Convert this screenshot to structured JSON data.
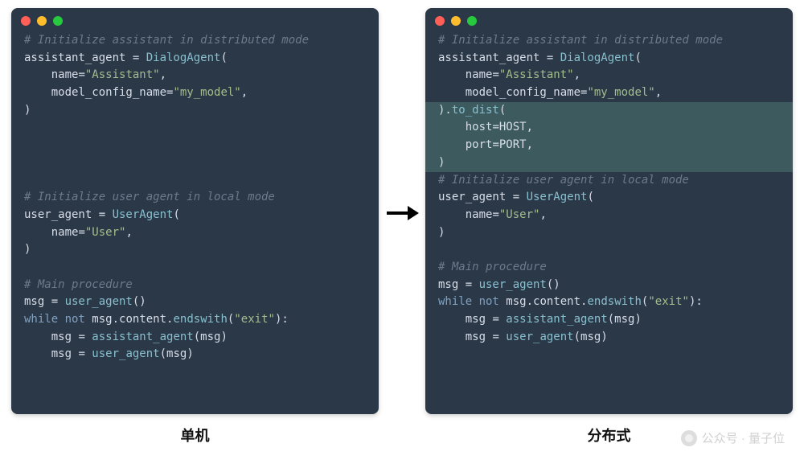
{
  "labels": {
    "left": "单机",
    "right": "分布式"
  },
  "watermark": "公众号 · 量子位",
  "left_code": {
    "lines": [
      {
        "hl": false,
        "tokens": [
          {
            "cls": "c-cm",
            "t": "# Initialize assistant in distributed mode"
          }
        ]
      },
      {
        "hl": false,
        "tokens": [
          {
            "cls": "c-id",
            "t": "assistant_agent "
          },
          {
            "cls": "c-op",
            "t": "= "
          },
          {
            "cls": "c-fn",
            "t": "DialogAgent"
          },
          {
            "cls": "c-pu",
            "t": "("
          }
        ]
      },
      {
        "hl": false,
        "tokens": [
          {
            "cls": "c-arg",
            "t": "    name"
          },
          {
            "cls": "c-op",
            "t": "="
          },
          {
            "cls": "c-str",
            "t": "\"Assistant\""
          },
          {
            "cls": "c-pu",
            "t": ","
          }
        ]
      },
      {
        "hl": false,
        "tokens": [
          {
            "cls": "c-arg",
            "t": "    model_config_name"
          },
          {
            "cls": "c-op",
            "t": "="
          },
          {
            "cls": "c-str",
            "t": "\"my_model\""
          },
          {
            "cls": "c-pu",
            "t": ","
          }
        ]
      },
      {
        "hl": false,
        "tokens": [
          {
            "cls": "c-pu",
            "t": ")"
          }
        ]
      },
      {
        "hl": false,
        "tokens": [
          {
            "cls": "c-pu",
            "t": " "
          }
        ]
      },
      {
        "hl": false,
        "tokens": [
          {
            "cls": "c-pu",
            "t": " "
          }
        ]
      },
      {
        "hl": false,
        "tokens": [
          {
            "cls": "c-pu",
            "t": " "
          }
        ]
      },
      {
        "hl": false,
        "tokens": [
          {
            "cls": "c-pu",
            "t": " "
          }
        ]
      },
      {
        "hl": false,
        "tokens": [
          {
            "cls": "c-cm",
            "t": "# Initialize user agent in local mode"
          }
        ]
      },
      {
        "hl": false,
        "tokens": [
          {
            "cls": "c-id",
            "t": "user_agent "
          },
          {
            "cls": "c-op",
            "t": "= "
          },
          {
            "cls": "c-fn",
            "t": "UserAgent"
          },
          {
            "cls": "c-pu",
            "t": "("
          }
        ]
      },
      {
        "hl": false,
        "tokens": [
          {
            "cls": "c-arg",
            "t": "    name"
          },
          {
            "cls": "c-op",
            "t": "="
          },
          {
            "cls": "c-str",
            "t": "\"User\""
          },
          {
            "cls": "c-pu",
            "t": ","
          }
        ]
      },
      {
        "hl": false,
        "tokens": [
          {
            "cls": "c-pu",
            "t": ")"
          }
        ]
      },
      {
        "hl": false,
        "tokens": [
          {
            "cls": "c-pu",
            "t": " "
          }
        ]
      },
      {
        "hl": false,
        "tokens": [
          {
            "cls": "c-cm",
            "t": "# Main procedure"
          }
        ]
      },
      {
        "hl": false,
        "tokens": [
          {
            "cls": "c-id",
            "t": "msg "
          },
          {
            "cls": "c-op",
            "t": "= "
          },
          {
            "cls": "c-fn",
            "t": "user_agent"
          },
          {
            "cls": "c-pu",
            "t": "()"
          }
        ]
      },
      {
        "hl": false,
        "tokens": [
          {
            "cls": "c-kw",
            "t": "while "
          },
          {
            "cls": "c-kw",
            "t": "not "
          },
          {
            "cls": "c-id",
            "t": "msg"
          },
          {
            "cls": "c-dot",
            "t": "."
          },
          {
            "cls": "c-id",
            "t": "content"
          },
          {
            "cls": "c-dot",
            "t": "."
          },
          {
            "cls": "c-fn",
            "t": "endswith"
          },
          {
            "cls": "c-pu",
            "t": "("
          },
          {
            "cls": "c-str",
            "t": "\"exit\""
          },
          {
            "cls": "c-pu",
            "t": "):"
          }
        ]
      },
      {
        "hl": false,
        "tokens": [
          {
            "cls": "c-id",
            "t": "    msg "
          },
          {
            "cls": "c-op",
            "t": "= "
          },
          {
            "cls": "c-fn",
            "t": "assistant_agent"
          },
          {
            "cls": "c-pu",
            "t": "("
          },
          {
            "cls": "c-id",
            "t": "msg"
          },
          {
            "cls": "c-pu",
            "t": ")"
          }
        ]
      },
      {
        "hl": false,
        "tokens": [
          {
            "cls": "c-id",
            "t": "    msg "
          },
          {
            "cls": "c-op",
            "t": "= "
          },
          {
            "cls": "c-fn",
            "t": "user_agent"
          },
          {
            "cls": "c-pu",
            "t": "("
          },
          {
            "cls": "c-id",
            "t": "msg"
          },
          {
            "cls": "c-pu",
            "t": ")"
          }
        ]
      },
      {
        "hl": false,
        "tokens": [
          {
            "cls": "c-pu",
            "t": " "
          }
        ]
      },
      {
        "hl": false,
        "tokens": [
          {
            "cls": "c-pu",
            "t": " "
          }
        ]
      }
    ]
  },
  "right_code": {
    "lines": [
      {
        "hl": false,
        "tokens": [
          {
            "cls": "c-cm",
            "t": "# Initialize assistant in distributed mode"
          }
        ]
      },
      {
        "hl": false,
        "tokens": [
          {
            "cls": "c-id",
            "t": "assistant_agent "
          },
          {
            "cls": "c-op",
            "t": "= "
          },
          {
            "cls": "c-fn",
            "t": "DialogAgent"
          },
          {
            "cls": "c-pu",
            "t": "("
          }
        ]
      },
      {
        "hl": false,
        "tokens": [
          {
            "cls": "c-arg",
            "t": "    name"
          },
          {
            "cls": "c-op",
            "t": "="
          },
          {
            "cls": "c-str",
            "t": "\"Assistant\""
          },
          {
            "cls": "c-pu",
            "t": ","
          }
        ]
      },
      {
        "hl": false,
        "tokens": [
          {
            "cls": "c-arg",
            "t": "    model_config_name"
          },
          {
            "cls": "c-op",
            "t": "="
          },
          {
            "cls": "c-str",
            "t": "\"my_model\""
          },
          {
            "cls": "c-pu",
            "t": ","
          }
        ]
      },
      {
        "hl": true,
        "tokens": [
          {
            "cls": "c-pu",
            "t": ")."
          },
          {
            "cls": "c-fn",
            "t": "to_dist"
          },
          {
            "cls": "c-pu",
            "t": "("
          }
        ]
      },
      {
        "hl": true,
        "tokens": [
          {
            "cls": "c-arg",
            "t": "    host"
          },
          {
            "cls": "c-op",
            "t": "="
          },
          {
            "cls": "c-id",
            "t": "HOST"
          },
          {
            "cls": "c-pu",
            "t": ","
          }
        ]
      },
      {
        "hl": true,
        "tokens": [
          {
            "cls": "c-arg",
            "t": "    port"
          },
          {
            "cls": "c-op",
            "t": "="
          },
          {
            "cls": "c-id",
            "t": "PORT"
          },
          {
            "cls": "c-pu",
            "t": ","
          }
        ]
      },
      {
        "hl": true,
        "tokens": [
          {
            "cls": "c-pu",
            "t": ")"
          }
        ]
      },
      {
        "hl": false,
        "tokens": [
          {
            "cls": "c-cm",
            "t": "# Initialize user agent in local mode"
          }
        ]
      },
      {
        "hl": false,
        "tokens": [
          {
            "cls": "c-id",
            "t": "user_agent "
          },
          {
            "cls": "c-op",
            "t": "= "
          },
          {
            "cls": "c-fn",
            "t": "UserAgent"
          },
          {
            "cls": "c-pu",
            "t": "("
          }
        ]
      },
      {
        "hl": false,
        "tokens": [
          {
            "cls": "c-arg",
            "t": "    name"
          },
          {
            "cls": "c-op",
            "t": "="
          },
          {
            "cls": "c-str",
            "t": "\"User\""
          },
          {
            "cls": "c-pu",
            "t": ","
          }
        ]
      },
      {
        "hl": false,
        "tokens": [
          {
            "cls": "c-pu",
            "t": ")"
          }
        ]
      },
      {
        "hl": false,
        "tokens": [
          {
            "cls": "c-pu",
            "t": " "
          }
        ]
      },
      {
        "hl": false,
        "tokens": [
          {
            "cls": "c-cm",
            "t": "# Main procedure"
          }
        ]
      },
      {
        "hl": false,
        "tokens": [
          {
            "cls": "c-id",
            "t": "msg "
          },
          {
            "cls": "c-op",
            "t": "= "
          },
          {
            "cls": "c-fn",
            "t": "user_agent"
          },
          {
            "cls": "c-pu",
            "t": "()"
          }
        ]
      },
      {
        "hl": false,
        "tokens": [
          {
            "cls": "c-kw",
            "t": "while "
          },
          {
            "cls": "c-kw",
            "t": "not "
          },
          {
            "cls": "c-id",
            "t": "msg"
          },
          {
            "cls": "c-dot",
            "t": "."
          },
          {
            "cls": "c-id",
            "t": "content"
          },
          {
            "cls": "c-dot",
            "t": "."
          },
          {
            "cls": "c-fn",
            "t": "endswith"
          },
          {
            "cls": "c-pu",
            "t": "("
          },
          {
            "cls": "c-str",
            "t": "\"exit\""
          },
          {
            "cls": "c-pu",
            "t": "):"
          }
        ]
      },
      {
        "hl": false,
        "tokens": [
          {
            "cls": "c-id",
            "t": "    msg "
          },
          {
            "cls": "c-op",
            "t": "= "
          },
          {
            "cls": "c-fn",
            "t": "assistant_agent"
          },
          {
            "cls": "c-pu",
            "t": "("
          },
          {
            "cls": "c-id",
            "t": "msg"
          },
          {
            "cls": "c-pu",
            "t": ")"
          }
        ]
      },
      {
        "hl": false,
        "tokens": [
          {
            "cls": "c-id",
            "t": "    msg "
          },
          {
            "cls": "c-op",
            "t": "= "
          },
          {
            "cls": "c-fn",
            "t": "user_agent"
          },
          {
            "cls": "c-pu",
            "t": "("
          },
          {
            "cls": "c-id",
            "t": "msg"
          },
          {
            "cls": "c-pu",
            "t": ")"
          }
        ]
      },
      {
        "hl": false,
        "tokens": [
          {
            "cls": "c-pu",
            "t": " "
          }
        ]
      },
      {
        "hl": false,
        "tokens": [
          {
            "cls": "c-pu",
            "t": " "
          }
        ]
      },
      {
        "hl": false,
        "tokens": [
          {
            "cls": "c-pu",
            "t": " "
          }
        ]
      }
    ]
  }
}
